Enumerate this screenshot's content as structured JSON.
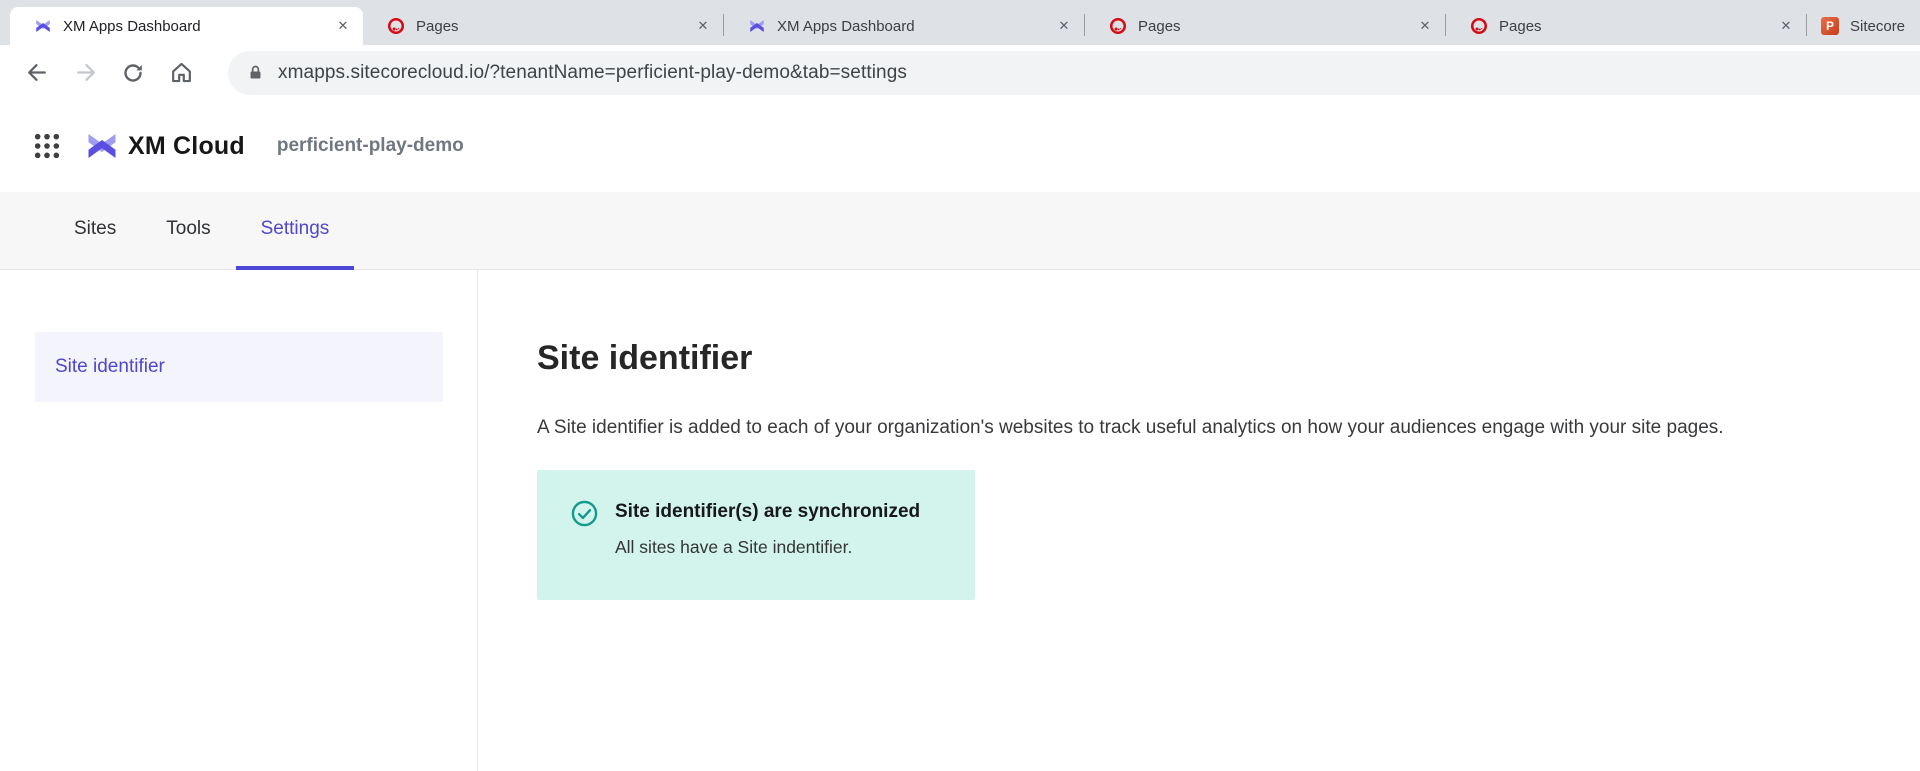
{
  "browser": {
    "tabs": [
      {
        "title": "XM Apps Dashboard",
        "icon": "xm-cloud-icon",
        "active": true
      },
      {
        "title": "Pages",
        "icon": "sitecore-icon",
        "active": false
      },
      {
        "title": "XM Apps Dashboard",
        "icon": "xm-cloud-icon",
        "active": false
      },
      {
        "title": "Pages",
        "icon": "sitecore-icon",
        "active": false
      },
      {
        "title": "Pages",
        "icon": "sitecore-icon",
        "active": false
      },
      {
        "title": "Sitecore",
        "icon": "powerpoint-icon",
        "active": false,
        "partial": true
      }
    ],
    "close_glyph": "✕",
    "powerpoint_letter": "P",
    "url": "xmapps.sitecorecloud.io/?tenantName=perficient-play-demo&tab=settings"
  },
  "app": {
    "product_name": "XM Cloud",
    "tenant": "perficient-play-demo",
    "nav_tabs": [
      {
        "label": "Sites",
        "active": false
      },
      {
        "label": "Tools",
        "active": false
      },
      {
        "label": "Settings",
        "active": true
      }
    ],
    "sidebar": {
      "items": [
        {
          "label": "Site identifier",
          "active": true
        }
      ]
    },
    "main": {
      "title": "Site identifier",
      "description": "A Site identifier is added to each of your organization's websites to track useful analytics on how your audiences engage with your site pages.",
      "alert": {
        "status": "success",
        "title": "Site identifier(s) are synchronized",
        "body": "All sites have a Site indentifier."
      }
    },
    "colors": {
      "accent_purple": "#4f46cf",
      "logo_purple_dark": "#5a4fe0",
      "logo_purple_light": "#a09cf0",
      "success_teal": "#11998c",
      "alert_background": "#d2f4ec",
      "selected_item_background": "#f4f4fd",
      "sitecore_red": "#d40b12"
    }
  }
}
